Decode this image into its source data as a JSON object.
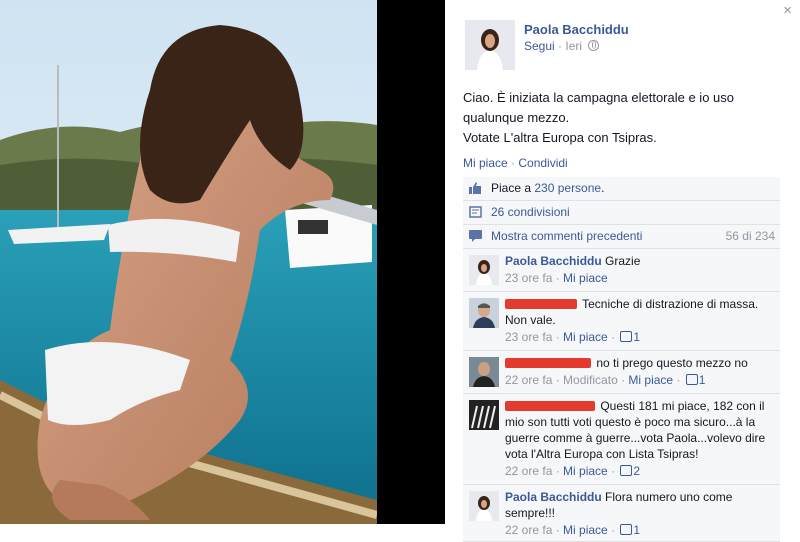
{
  "author": {
    "name": "Paola Bacchiddu",
    "follow_label": "Segui",
    "timestamp": "Ieri"
  },
  "close_label": "×",
  "post": {
    "lines": [
      "Ciao. È iniziata la campagna elettorale e io uso",
      "qualunque mezzo.",
      "Votate L'altra Europa con Tsipras."
    ]
  },
  "actions": {
    "like": "Mi piace",
    "sep": " · ",
    "share": "Condividi"
  },
  "ufi": {
    "likes_prefix": "Piace a ",
    "likes_link": "230 persone",
    "likes_suffix": ".",
    "shares": "26 condivisioni",
    "prev_comments": "Mostra commenti precedenti",
    "prev_count": "56 di 234"
  },
  "comments": [
    {
      "name": "Paola Bacchiddu",
      "text": "Grazie",
      "time": "23 ore fa",
      "like": "Mi piace",
      "count": ""
    },
    {
      "name": "",
      "text": "Tecniche di distrazione di massa. Non vale.",
      "time": "23 ore fa",
      "like": "Mi piace",
      "count": "1"
    },
    {
      "name": "",
      "text": "no ti prego questo mezzo no",
      "time": "22 ore fa",
      "edited": "Modificato",
      "like": "Mi piace",
      "count": "1"
    },
    {
      "name": "",
      "text": "Questi 181 mi piace, 182 con il mio son tutti voti questo è poco ma sicuro...à la guerre comme à guerre...vota Paola...volevo dire vota l'Altra Europa con Lista Tsipras!",
      "time": "22 ore fa",
      "like": "Mi piace",
      "count": "2"
    },
    {
      "name": "Paola Bacchiddu",
      "text": "Flora numero uno come sempre!!!",
      "time": "22 ore fa",
      "like": "Mi piace",
      "count": "1"
    }
  ],
  "colors": {
    "link": "#3b5998",
    "meta": "#9197a3",
    "redaction": "#e53a2e",
    "ufi_bg": "#f6f7f8"
  }
}
